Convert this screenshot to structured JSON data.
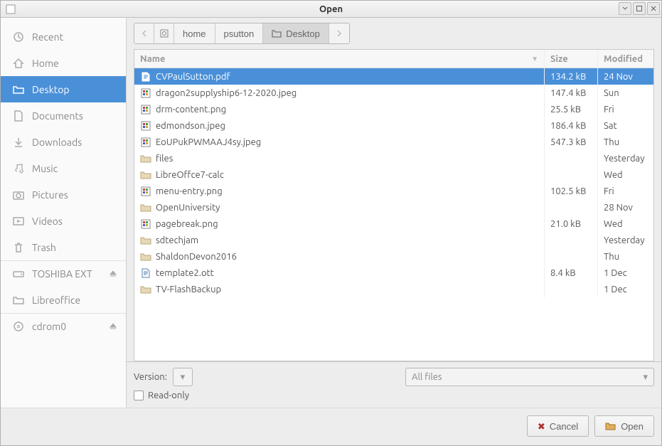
{
  "window": {
    "title": "Open"
  },
  "sidebar": {
    "items": [
      {
        "label": "Recent",
        "icon": "clock-icon",
        "eject": false,
        "sep": false
      },
      {
        "label": "Home",
        "icon": "home-icon",
        "eject": false,
        "sep": false
      },
      {
        "label": "Desktop",
        "icon": "folder-icon",
        "eject": false,
        "sep": false
      },
      {
        "label": "Documents",
        "icon": "document-icon",
        "eject": false,
        "sep": false
      },
      {
        "label": "Downloads",
        "icon": "download-icon",
        "eject": false,
        "sep": false
      },
      {
        "label": "Music",
        "icon": "music-icon",
        "eject": false,
        "sep": false
      },
      {
        "label": "Pictures",
        "icon": "camera-icon",
        "eject": false,
        "sep": false
      },
      {
        "label": "Videos",
        "icon": "video-icon",
        "eject": false,
        "sep": false
      },
      {
        "label": "Trash",
        "icon": "trash-icon",
        "eject": false,
        "sep": false
      },
      {
        "label": "TOSHIBA EXT",
        "icon": "drive-icon",
        "eject": true,
        "sep": true
      },
      {
        "label": "Libreoffice",
        "icon": "folder-icon",
        "eject": false,
        "sep": false
      },
      {
        "label": "cdrom0",
        "icon": "disc-icon",
        "eject": true,
        "sep": true
      }
    ],
    "selected_index": 2
  },
  "pathbar": {
    "buttons": [
      {
        "label": "home",
        "current": false
      },
      {
        "label": "psutton",
        "current": false
      },
      {
        "label": "Desktop",
        "current": true
      }
    ]
  },
  "filelist": {
    "columns": {
      "name": "Name",
      "size": "Size",
      "modified": "Modified"
    },
    "sort_column": "name",
    "rows": [
      {
        "name": "CVPaulSutton.pdf",
        "size": "134.2 kB",
        "modified": "24 Nov",
        "type": "pdf",
        "selected": true
      },
      {
        "name": "dragon2supplyship6-12-2020.jpeg",
        "size": "147.4 kB",
        "modified": "Sun",
        "type": "image",
        "selected": false
      },
      {
        "name": "drm-content.png",
        "size": "25.5 kB",
        "modified": "Fri",
        "type": "image",
        "selected": false
      },
      {
        "name": "edmondson.jpeg",
        "size": "186.4 kB",
        "modified": "Sat",
        "type": "image",
        "selected": false
      },
      {
        "name": "EoUPukPWMAAJ4sy.jpeg",
        "size": "547.3 kB",
        "modified": "Thu",
        "type": "image",
        "selected": false
      },
      {
        "name": "files",
        "size": "",
        "modified": "Yesterday",
        "type": "folder",
        "selected": false
      },
      {
        "name": "LibreOffce7-calc",
        "size": "",
        "modified": "Wed",
        "type": "folder",
        "selected": false
      },
      {
        "name": "menu-entry.png",
        "size": "102.5 kB",
        "modified": "Fri",
        "type": "image",
        "selected": false
      },
      {
        "name": "OpenUniversity",
        "size": "",
        "modified": "28 Nov",
        "type": "folder",
        "selected": false
      },
      {
        "name": "pagebreak.png",
        "size": "21.0 kB",
        "modified": "Wed",
        "type": "image",
        "selected": false
      },
      {
        "name": "sdtechjam",
        "size": "",
        "modified": "Yesterday",
        "type": "folder",
        "selected": false
      },
      {
        "name": "ShaldonDevon2016",
        "size": "",
        "modified": "Thu",
        "type": "folder",
        "selected": false
      },
      {
        "name": "template2.ott",
        "size": "8.4 kB",
        "modified": "1 Dec",
        "type": "doc",
        "selected": false
      },
      {
        "name": "TV-FlashBackup",
        "size": "",
        "modified": "1 Dec",
        "type": "folder",
        "selected": false
      }
    ]
  },
  "footer": {
    "version_label": "Version:",
    "readonly_label": "Read-only",
    "filter_label": "All files",
    "cancel_label": "Cancel",
    "open_label": "Open"
  }
}
